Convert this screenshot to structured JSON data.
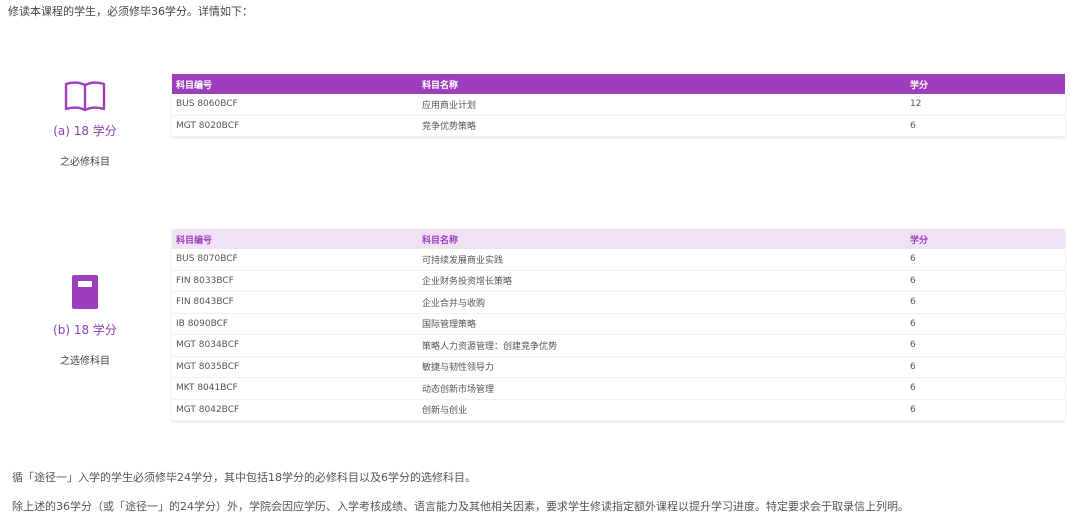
{
  "intro": "修读本课程的学生，必须修毕36学分。详情如下：",
  "core": {
    "credits": "(a) 18 学分",
    "caption": "之必修科目",
    "headers": [
      "科目编号",
      "科目名称",
      "学分"
    ],
    "rows": [
      [
        "BUS 8060BCF",
        "应用商业计划",
        "12"
      ],
      [
        "MGT 8020BCF",
        "竞争优势策略",
        "6"
      ]
    ]
  },
  "elective": {
    "credits": "(b) 18 学分",
    "caption": "之选修科目",
    "headers": [
      "科目编号",
      "科目名称",
      "学分"
    ],
    "rows": [
      [
        "BUS 8070BCF",
        "可持续发展商业实践",
        "6"
      ],
      [
        "FIN 8033BCF",
        "企业财务投资增长策略",
        "6"
      ],
      [
        "FIN 8043BCF",
        "企业合并与收购",
        "6"
      ],
      [
        "IB 8090BCF",
        "国际管理策略",
        "6"
      ],
      [
        "MGT 8034BCF",
        "策略人力资源管理：创建竞争优势",
        "6"
      ],
      [
        "MGT 8035BCF",
        "敏捷与韧性领导力",
        "6"
      ],
      [
        "MKT 8041BCF",
        "动态创新市场管理",
        "6"
      ],
      [
        "MGT 8042BCF",
        "创新与创业",
        "6"
      ]
    ]
  },
  "notes": [
    "循「途径一」入学的学生必须修毕24学分，其中包括18学分的必修科目以及6学分的选修科目。",
    "除上述的36学分（或「途径一」的24学分）外，学院会因应学历、入学考核成绩、语言能力及其他相关因素，要求学生修读指定额外课程以提升学习进度。特定要求会于取录信上列明。"
  ],
  "icons": {
    "core": "open-book-icon",
    "elective": "closed-book-icon"
  },
  "colors": {
    "accent": "#9d3fbd",
    "header_light": "#f1e1f4"
  }
}
